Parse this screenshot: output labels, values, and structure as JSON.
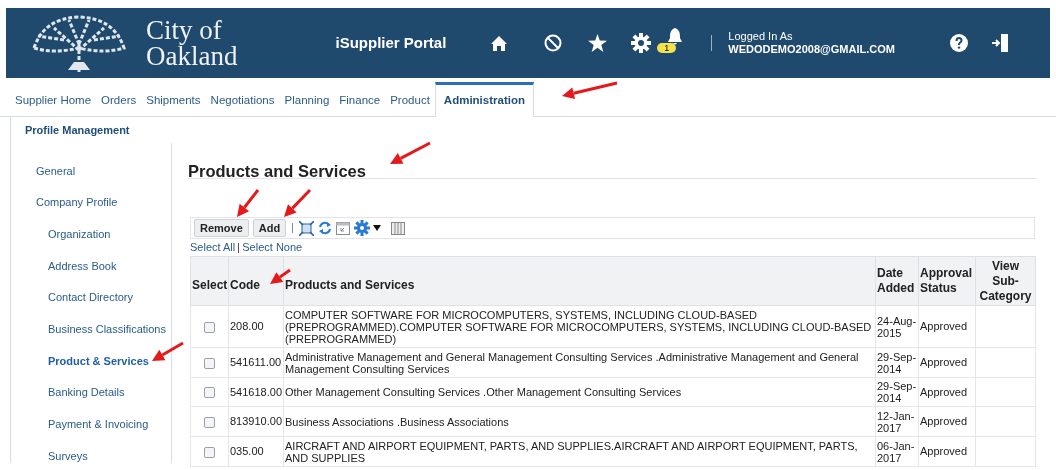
{
  "header": {
    "logo_line1": "City of",
    "logo_line2": "Oakland",
    "portal_title": "iSupplier Portal",
    "notification_count": "1",
    "logged_in_label": "Logged In As",
    "user": "WEDODEMO2008@GMAIL.COM"
  },
  "tabs": [
    {
      "label": "Supplier Home",
      "selected": false
    },
    {
      "label": "Orders",
      "selected": false
    },
    {
      "label": "Shipments",
      "selected": false
    },
    {
      "label": "Negotiations",
      "selected": false
    },
    {
      "label": "Planning",
      "selected": false
    },
    {
      "label": "Finance",
      "selected": false
    },
    {
      "label": "Product",
      "selected": false
    },
    {
      "label": "Administration",
      "selected": true
    }
  ],
  "subtab": "Profile Management",
  "sidebar": {
    "items": [
      {
        "label": "General",
        "selected": false
      },
      {
        "label": "Company Profile",
        "selected": false,
        "children": [
          {
            "label": "Organization",
            "selected": false
          },
          {
            "label": "Address Book",
            "selected": false
          },
          {
            "label": "Contact Directory",
            "selected": false
          },
          {
            "label": "Business Classifications",
            "selected": false
          },
          {
            "label": "Product & Services",
            "selected": true
          },
          {
            "label": "Banking Details",
            "selected": false
          },
          {
            "label": "Payment & Invoicing",
            "selected": false
          },
          {
            "label": "Surveys",
            "selected": false
          }
        ]
      }
    ]
  },
  "page_title": "Products and Services",
  "toolbar": {
    "buttons": [
      "Remove",
      "Add"
    ],
    "select_all": "Select All",
    "select_none": "Select None"
  },
  "table": {
    "columns": [
      "Select",
      "Code",
      "Products and Services",
      "Date Added",
      "Approval Status",
      "View Sub-Category"
    ],
    "rows": [
      {
        "checked": false,
        "code": "208.00",
        "description": "COMPUTER SOFTWARE FOR MICROCOMPUTERS, SYSTEMS, INCLUDING CLOUD-BASED (PREPROGRAMMED).COMPUTER SOFTWARE FOR MICROCOMPUTERS, SYSTEMS, INCLUDING CLOUD-BASED (PREPROGRAMMED)",
        "date": "24-Aug-2015",
        "status": "Approved"
      },
      {
        "checked": false,
        "code": "541611.00",
        "description": "Administrative Management and General Management Consulting Services .Administrative Management and General Management Consulting Services",
        "date": "29-Sep-2014",
        "status": "Approved"
      },
      {
        "checked": false,
        "code": "541618.00",
        "description": "Other Management Consulting Services .Other Management Consulting Services",
        "date": "29-Sep-2014",
        "status": "Approved"
      },
      {
        "checked": false,
        "code": "813910.00",
        "description": "Business Associations .Business Associations",
        "date": "12-Jan-2017",
        "status": "Approved"
      },
      {
        "checked": false,
        "code": "035.00",
        "description": "AIRCRAFT AND AIRPORT EQUIPMENT, PARTS, AND SUPPLIES.AIRCRAFT AND AIRPORT EQUIPMENT, PARTS, AND SUPPLIES",
        "date": "06-Jan-2017",
        "status": "Approved"
      }
    ]
  }
}
